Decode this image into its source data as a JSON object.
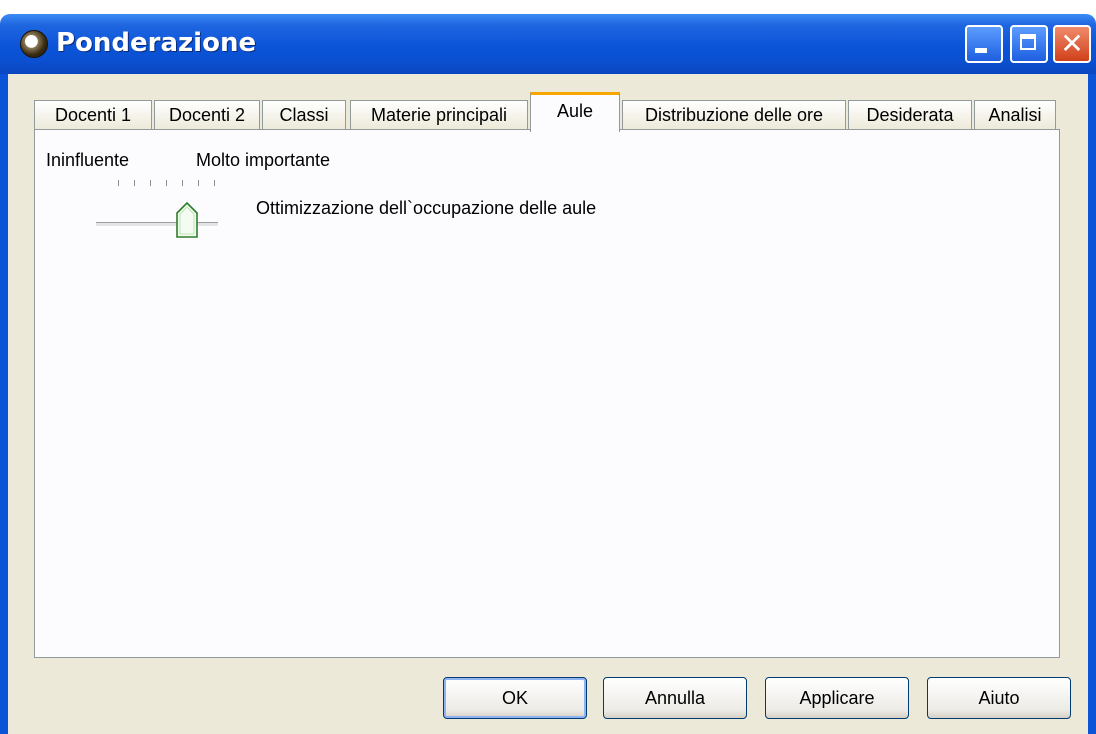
{
  "window": {
    "title": "Ponderazione"
  },
  "tabs": [
    {
      "label": "Docenti 1"
    },
    {
      "label": "Docenti 2"
    },
    {
      "label": "Classi"
    },
    {
      "label": "Materie principali"
    },
    {
      "label": "Aule"
    },
    {
      "label": "Distribuzione delle ore"
    },
    {
      "label": "Desiderata"
    },
    {
      "label": "Analisi"
    }
  ],
  "active_tab": "Aule",
  "weighting": {
    "low_label": "Ininfluente",
    "high_label": "Molto importante",
    "criterion_label": "Ottimizzazione dell`occupazione delle aule",
    "slider_level_fraction": 0.75
  },
  "buttons": {
    "ok": "OK",
    "cancel": "Annulla",
    "apply": "Applicare",
    "help": "Aiuto"
  },
  "colors": {
    "titlebar": "#0b54d8",
    "active_tab_accent": "#f7a500",
    "face": "#ece9d8"
  }
}
